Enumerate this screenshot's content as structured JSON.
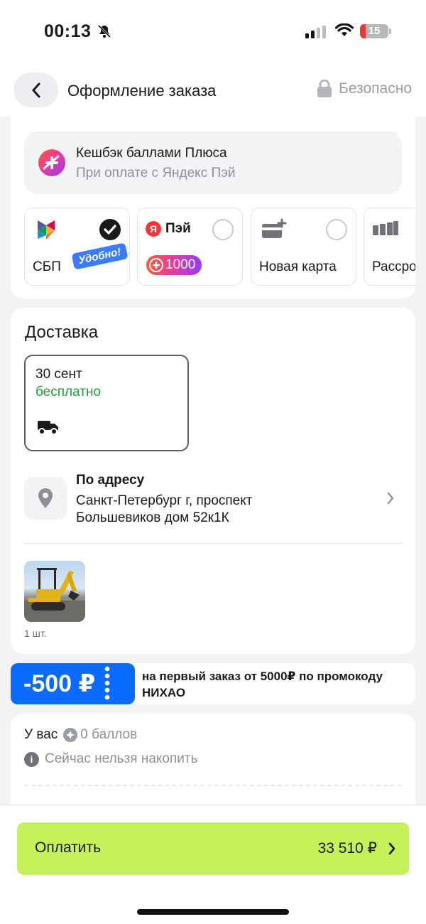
{
  "status_bar": {
    "time": "00:13",
    "battery": "15",
    "icons": [
      "bell-off-icon",
      "signal-icon",
      "wifi-icon",
      "battery-icon"
    ]
  },
  "header": {
    "title": "Оформление заказа",
    "secure_label": "Безопасно"
  },
  "payment": {
    "cashback_title": "Кешбэк баллами Плюса",
    "cashback_subtitle": "При оплате с Яндекс Пэй",
    "methods": [
      {
        "label": "СБП",
        "badge": "Удобно!",
        "selected": true
      },
      {
        "label": "Пэй",
        "bonus": "1000",
        "selected": false
      },
      {
        "label": "Новая карта",
        "selected": false
      },
      {
        "label": "Рассрочка",
        "selected": false
      }
    ]
  },
  "delivery": {
    "title": "Доставка",
    "slot_date": "30 сент",
    "slot_price": "бесплатно",
    "address_title": "По адресу",
    "address_line1": "Санкт-Петербург г, проспект",
    "address_line2": "Большевиков дом 52к1К",
    "quantity": "1 шт."
  },
  "promo": {
    "amount": "-500 ₽",
    "text": "на первый заказ от 5000₽ по промокоду НИХАО"
  },
  "points": {
    "prefix": "У вас",
    "balance": "0 баллов",
    "note": "Сейчас нельзя накопить"
  },
  "checkout": {
    "pay_label": "Оплатить",
    "total": "33 510 ₽"
  },
  "colors": {
    "pay_button": "#c5f25a",
    "promo_blue": "#0a6cff",
    "free_green": "#21a038"
  }
}
